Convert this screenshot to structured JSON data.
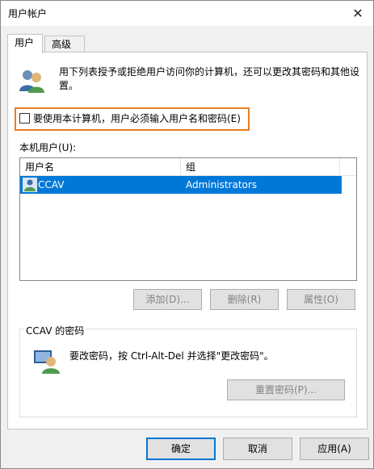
{
  "window": {
    "title": "用户帐户",
    "close_glyph": "✕"
  },
  "tabs": [
    {
      "label": "用户",
      "active": true
    },
    {
      "label": "高级",
      "active": false
    }
  ],
  "intro_text": "用下列表授予或拒绝用户访问你的计算机，还可以更改其密码和其他设置。",
  "require_login_checkbox": {
    "label": "要使用本计算机，用户必须输入用户名和密码(E)",
    "checked": false
  },
  "local_users": {
    "label": "本机用户(U):",
    "columns": [
      "用户名",
      "组"
    ],
    "rows": [
      {
        "name": "CCAV",
        "group": "Administrators",
        "selected": true
      }
    ]
  },
  "user_buttons": {
    "add": "添加(D)...",
    "remove": "删除(R)",
    "properties": "属性(O)"
  },
  "password_group": {
    "title": "CCAV 的密码",
    "text": "要改密码，按 Ctrl-Alt-Del 并选择\"更改密码\"。",
    "reset_button": "重置密码(P)..."
  },
  "dialog_buttons": {
    "ok": "确定",
    "cancel": "取消",
    "apply": "应用(A)"
  },
  "colors": {
    "selection": "#0078d7",
    "highlight_border": "#e87d22"
  }
}
